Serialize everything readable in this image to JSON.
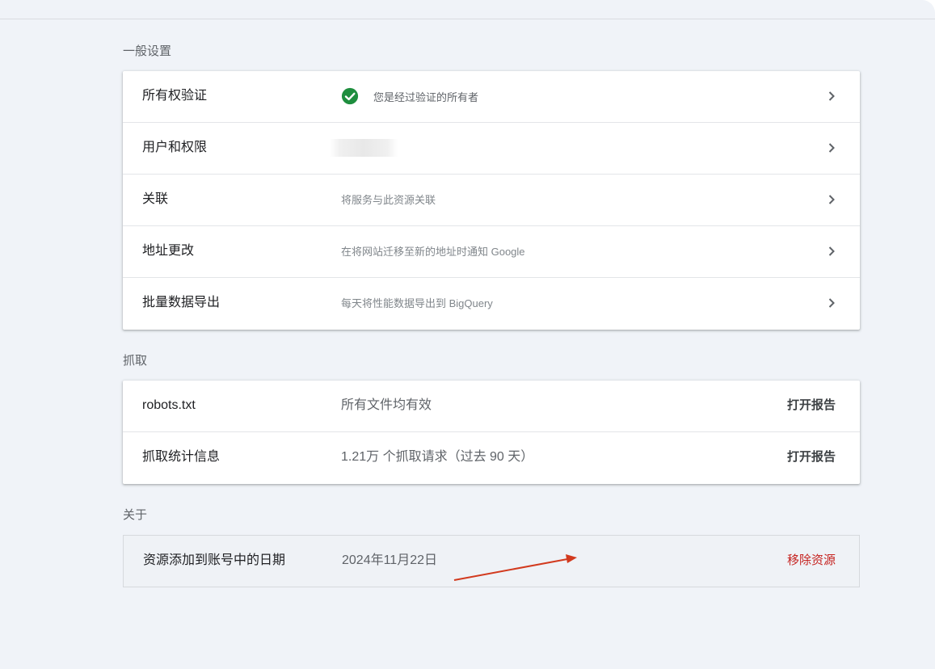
{
  "general": {
    "title": "一般设置",
    "ownership": {
      "label": "所有权验证",
      "status": "您是经过验证的所有者"
    },
    "users": {
      "label": "用户和权限"
    },
    "association": {
      "label": "关联",
      "desc": "将服务与此资源关联"
    },
    "address": {
      "label": "地址更改",
      "desc": "在将网站迁移至新的地址时通知 Google"
    },
    "export": {
      "label": "批量数据导出",
      "desc": "每天将性能数据导出到 BigQuery"
    }
  },
  "crawl": {
    "title": "抓取",
    "robots": {
      "label": "robots.txt",
      "value": "所有文件均有效",
      "action": "打开报告"
    },
    "stats": {
      "label": "抓取统计信息",
      "value": "1.21万 个抓取请求（过去 90 天）",
      "action": "打开报告"
    }
  },
  "about": {
    "title": "关于",
    "added": {
      "label": "资源添加到账号中的日期",
      "value": "2024年11月22日",
      "action": "移除资源"
    }
  },
  "colors": {
    "background": "#f0f3f8",
    "check": "#1e8e3e",
    "danger": "#c5221f",
    "annotation_arrow": "#d23a1e"
  },
  "icons": [
    "check-circle-icon",
    "chevron-right-icon"
  ]
}
